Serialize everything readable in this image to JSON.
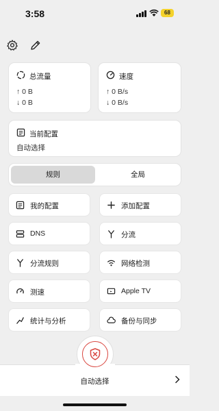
{
  "status_bar": {
    "time": "3:58",
    "battery": "68"
  },
  "toolbar": {
    "settings_icon": "gear-icon",
    "edit_icon": "pencil-icon"
  },
  "traffic": {
    "title": "总流量",
    "up": "↑ 0 B",
    "down": "↓ 0 B"
  },
  "speed": {
    "title": "速度",
    "up": "↑ 0 B/s",
    "down": "↓ 0 B/s"
  },
  "current_config": {
    "title": "当前配置",
    "value": "自动选择"
  },
  "mode_tabs": [
    {
      "label": "规则",
      "active": true
    },
    {
      "label": "全局",
      "active": false
    }
  ],
  "tiles": [
    {
      "label": "我的配置",
      "icon": "document-icon"
    },
    {
      "label": "添加配置",
      "icon": "plus-icon"
    },
    {
      "label": "DNS",
      "icon": "server-icon"
    },
    {
      "label": "分流",
      "icon": "split-icon"
    },
    {
      "label": "分流规则",
      "icon": "split-rules-icon"
    },
    {
      "label": "网络检测",
      "icon": "wifi-icon"
    },
    {
      "label": "测速",
      "icon": "speedometer-icon"
    },
    {
      "label": "Apple TV",
      "icon": "tv-icon"
    },
    {
      "label": "统计与分析",
      "icon": "chart-icon"
    },
    {
      "label": "备份与同步",
      "icon": "cloud-icon"
    }
  ],
  "bottom": {
    "label": "自动选择"
  },
  "colors": {
    "accent": "#d9463f",
    "background": "#efefef"
  }
}
